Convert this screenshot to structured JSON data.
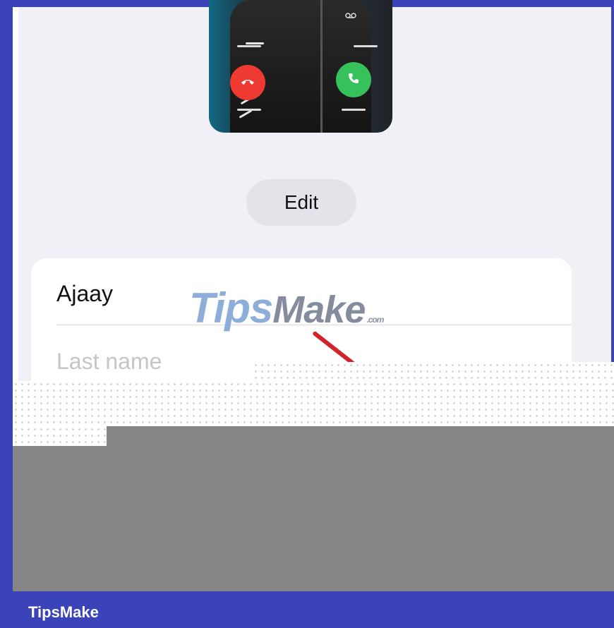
{
  "poster": {
    "decline_icon": "phone-down-icon",
    "accept_icon": "phone-icon",
    "voicemail_icon": "voicemail-icon"
  },
  "edit_button": {
    "label": "Edit"
  },
  "name_card": {
    "first_name_value": "Ajaay",
    "last_name_placeholder": "Last name"
  },
  "watermark": {
    "brand": "Tips",
    "brand_second": "Make",
    "suffix": ".com"
  },
  "footer": {
    "brand": "TipsMake"
  },
  "colors": {
    "accept_green": "#36c15b",
    "decline_red": "#ee3a30",
    "footer_blue": "#3a44b8",
    "arrow_red": "#d2232a"
  }
}
